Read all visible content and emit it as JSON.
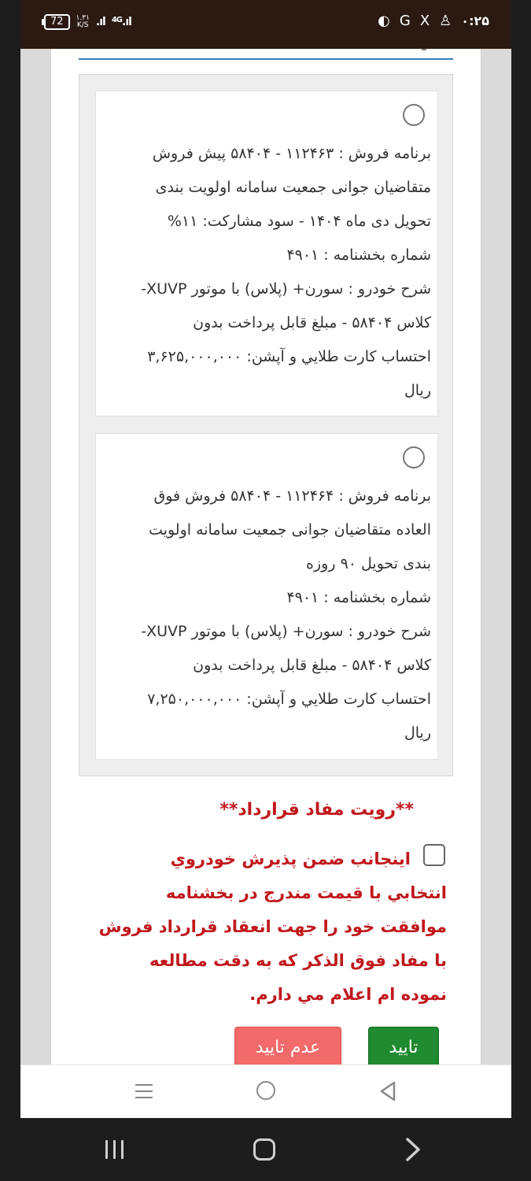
{
  "status_bar": {
    "battery": "72",
    "speed_value": "۱.۳۱",
    "speed_unit": "K/S",
    "network": "4G",
    "time": "۰:۲۵",
    "icons": [
      "signal-icon",
      "dnd-icon",
      "chrome-icon",
      "x-icon",
      "notification-icon"
    ]
  },
  "options": [
    {
      "lines": [
        "برنامه فروش : ۱۱۲۴۶۳ - ۵۸۴۰۴ پیش فروش",
        "متقاضیان جوانی جمعیت سامانه اولویت بندی",
        "تحویل دی ماه ۱۴۰۴ - سود مشارکت: ۱۱%",
        "شماره بخشنامه : ۴۹۰۱",
        "شرح خودرو : سورن+ (پلاس) با موتور XUVP-",
        "کلاس ۵۸۴۰۴ - مبلغ قابل پرداخت بدون",
        "احتساب کارت طلايي و آپشن: ۳,۶۲۵,۰۰۰,۰۰۰",
        "ريال"
      ]
    },
    {
      "lines": [
        "برنامه فروش : ۱۱۲۴۶۴ - ۵۸۴۰۴ فروش فوق",
        "العاده متقاضیان جوانی جمعیت سامانه اولویت",
        "بندی تحویل ۹۰ روزه",
        "شماره بخشنامه : ۴۹۰۱",
        "شرح خودرو : سورن+ (پلاس) با موتور XUVP-",
        "کلاس ۵۸۴۰۴ - مبلغ قابل پرداخت بدون",
        "احتساب کارت طلايي و آپشن: ۷,۲۵۰,۰۰۰,۰۰۰",
        "ريال"
      ]
    }
  ],
  "terms": {
    "title": "**رويت مفاد قرارداد**",
    "lines": [
      "اينجانب ضمن پذيرش خودروي",
      "انتخابي با قيمت مندرج در بخشنامه",
      "موافقت خود را جهت انعقاد قرارداد فروش",
      "با مفاد فوق الذكر كه به دقت مطالعه",
      "نموده ام اعلام مي دارم."
    ]
  },
  "buttons": {
    "confirm": "تاييد",
    "reject": "عدم تاييد"
  },
  "colors": {
    "status_bar": "#2a1a12",
    "accent_blue": "#3c7fbf",
    "terms_red": "#c0181c",
    "confirm_green": "#1f8a2f",
    "reject_red": "#f26a6a"
  }
}
